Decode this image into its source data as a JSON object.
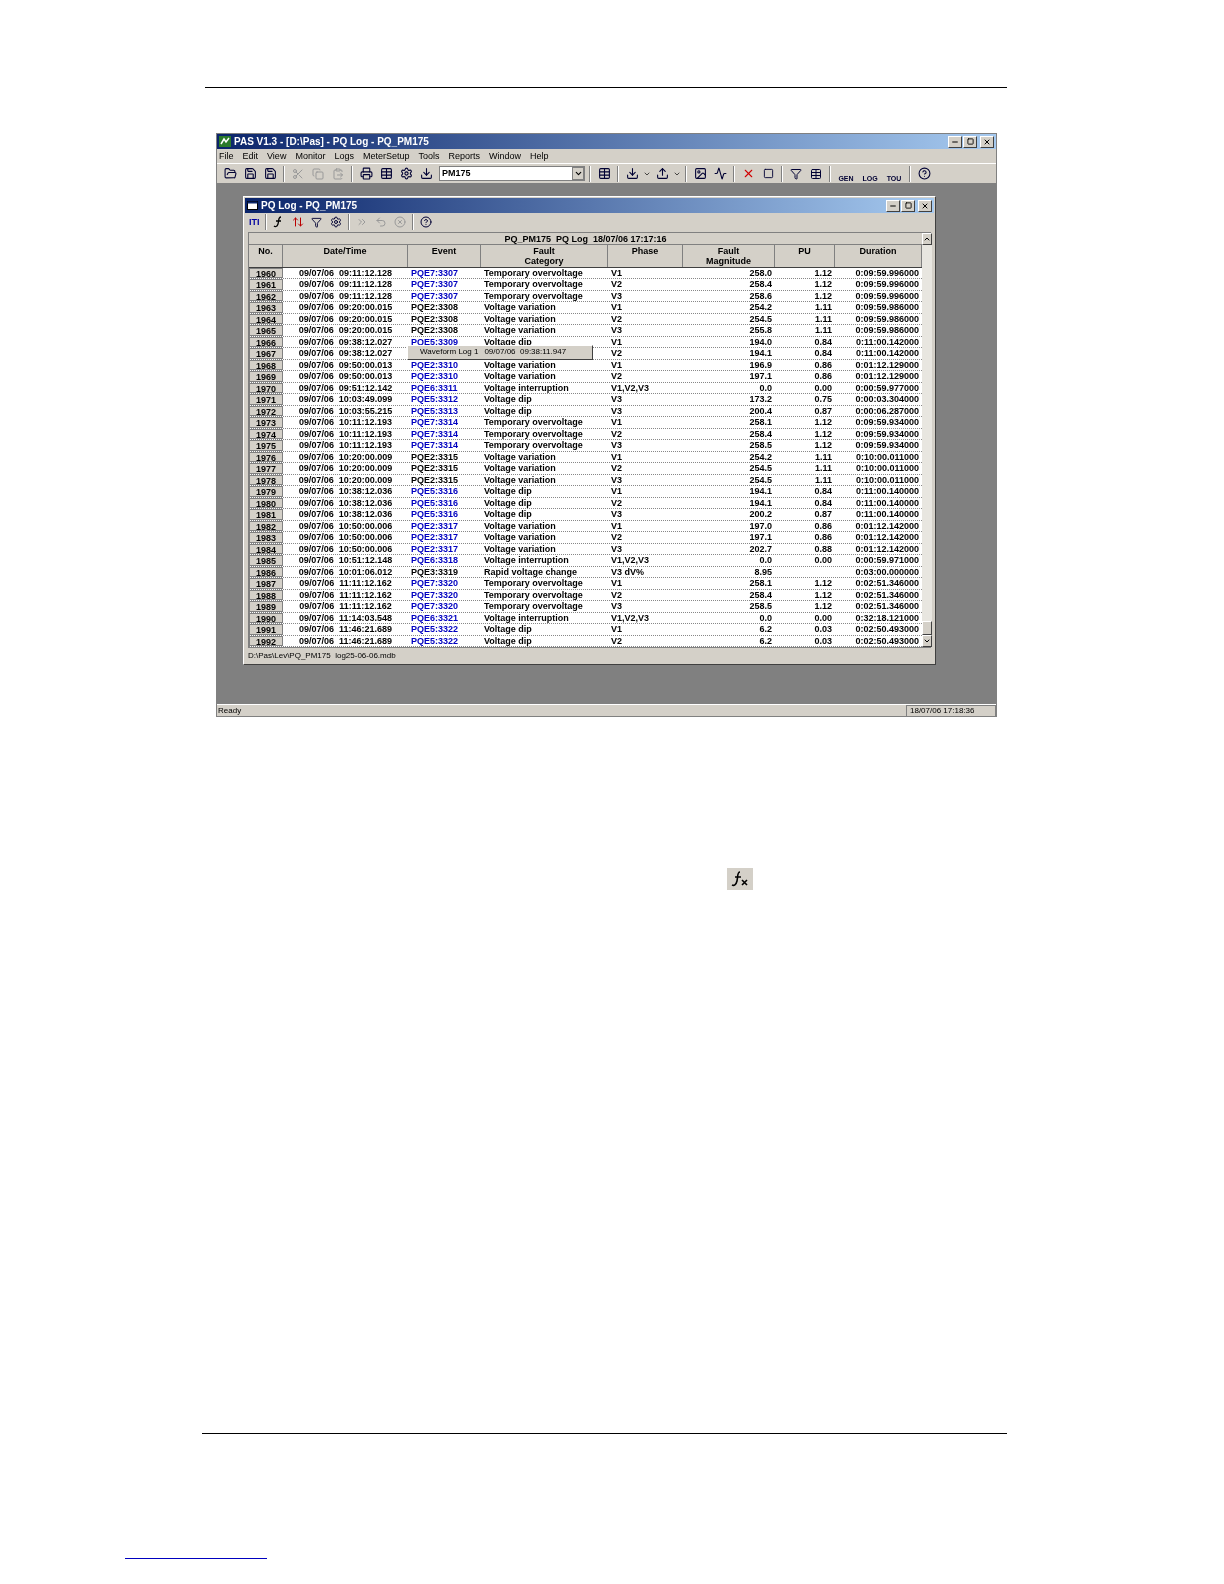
{
  "app_window": {
    "title": "PAS V1.3 - [D:\\Pas] - PQ Log - PQ_PM175",
    "menu": [
      "File",
      "Edit",
      "View",
      "Monitor",
      "Logs",
      "MeterSetup",
      "Tools",
      "Reports",
      "Window",
      "Help"
    ],
    "device_select": "PM175",
    "icon_labels": [
      "GEN",
      "LOG",
      "TOU"
    ]
  },
  "log_window": {
    "title": "PQ Log - PQ_PM175",
    "toolbar_label": "ITI",
    "table": {
      "caption": "PQ_PM175  PQ Log  18/07/06 17:17:16",
      "columns": [
        "No.",
        "Date/Time",
        "Event",
        "Fault\nCategory",
        "Phase",
        "Fault\nMagnitude",
        "PU",
        "Duration"
      ],
      "rows": [
        {
          "no": "1960",
          "datetime": "09/07/06  09:11:12.128",
          "event": "PQE7:3307",
          "link": true,
          "category": "Temporary overvoltage",
          "phase": "V1",
          "magnitude": "258.0",
          "pu": "1.12",
          "duration": "0:09:59.996000"
        },
        {
          "no": "1961",
          "datetime": "09/07/06  09:11:12.128",
          "event": "PQE7:3307",
          "link": true,
          "category": "Temporary overvoltage",
          "phase": "V2",
          "magnitude": "258.4",
          "pu": "1.12",
          "duration": "0:09:59.996000"
        },
        {
          "no": "1962",
          "datetime": "09/07/06  09:11:12.128",
          "event": "PQE7:3307",
          "link": true,
          "category": "Temporary overvoltage",
          "phase": "V3",
          "magnitude": "258.6",
          "pu": "1.12",
          "duration": "0:09:59.996000"
        },
        {
          "no": "1963",
          "datetime": "09/07/06  09:20:00.015",
          "event": "PQE2:3308",
          "link": false,
          "category": "Voltage variation",
          "phase": "V1",
          "magnitude": "254.2",
          "pu": "1.11",
          "duration": "0:09:59.986000"
        },
        {
          "no": "1964",
          "datetime": "09/07/06  09:20:00.015",
          "event": "PQE2:3308",
          "link": false,
          "category": "Voltage variation",
          "phase": "V2",
          "magnitude": "254.5",
          "pu": "1.11",
          "duration": "0:09:59.986000"
        },
        {
          "no": "1965",
          "datetime": "09/07/06  09:20:00.015",
          "event": "PQE2:3308",
          "link": false,
          "category": "Voltage variation",
          "phase": "V3",
          "magnitude": "255.8",
          "pu": "1.11",
          "duration": "0:09:59.986000"
        },
        {
          "no": "1966",
          "datetime": "09/07/06  09:38:12.027",
          "event": "PQE5:3309",
          "link": true,
          "category": "Voltage dip",
          "phase": "V1",
          "magnitude": "194.0",
          "pu": "0.84",
          "duration": "0:11:00.142000"
        },
        {
          "no": "1967",
          "datetime": "09/07/06  09:38:12.027",
          "phase": "V2",
          "magnitude": "194.1",
          "pu": "0.84",
          "duration": "0:11:00.142000"
        },
        {
          "no": "1968",
          "datetime": "09/07/06  09:50:00.013",
          "event": "PQE2:3310",
          "link": true,
          "category": "Voltage variation",
          "phase": "V1",
          "magnitude": "196.9",
          "pu": "0.86",
          "duration": "0:01:12.129000"
        },
        {
          "no": "1969",
          "datetime": "09/07/06  09:50:00.013",
          "event": "PQE2:3310",
          "link": true,
          "category": "Voltage variation",
          "phase": "V2",
          "magnitude": "197.1",
          "pu": "0.86",
          "duration": "0:01:12.129000"
        },
        {
          "no": "1970",
          "datetime": "09/07/06  09:51:12.142",
          "event": "PQE6:3311",
          "link": true,
          "category": "Voltage interruption",
          "phase": "V1,V2,V3",
          "magnitude": "0.0",
          "pu": "0.00",
          "duration": "0:00:59.977000"
        },
        {
          "no": "1971",
          "datetime": "09/07/06  10:03:49.099",
          "event": "PQE5:3312",
          "link": true,
          "category": "Voltage dip",
          "phase": "V3",
          "magnitude": "173.2",
          "pu": "0.75",
          "duration": "0:00:03.304000"
        },
        {
          "no": "1972",
          "datetime": "09/07/06  10:03:55.215",
          "event": "PQE5:3313",
          "link": true,
          "category": "Voltage dip",
          "phase": "V3",
          "magnitude": "200.4",
          "pu": "0.87",
          "duration": "0:00:06.287000"
        },
        {
          "no": "1973",
          "datetime": "09/07/06  10:11:12.193",
          "event": "PQE7:3314",
          "link": true,
          "category": "Temporary overvoltage",
          "phase": "V1",
          "magnitude": "258.1",
          "pu": "1.12",
          "duration": "0:09:59.934000"
        },
        {
          "no": "1974",
          "datetime": "09/07/06  10:11:12.193",
          "event": "PQE7:3314",
          "link": true,
          "category": "Temporary overvoltage",
          "phase": "V2",
          "magnitude": "258.4",
          "pu": "1.12",
          "duration": "0:09:59.934000"
        },
        {
          "no": "1975",
          "datetime": "09/07/06  10:11:12.193",
          "event": "PQE7:3314",
          "link": true,
          "category": "Temporary overvoltage",
          "phase": "V3",
          "magnitude": "258.5",
          "pu": "1.12",
          "duration": "0:09:59.934000"
        },
        {
          "no": "1976",
          "datetime": "09/07/06  10:20:00.009",
          "event": "PQE2:3315",
          "link": false,
          "category": "Voltage variation",
          "phase": "V1",
          "magnitude": "254.2",
          "pu": "1.11",
          "duration": "0:10:00.011000"
        },
        {
          "no": "1977",
          "datetime": "09/07/06  10:20:00.009",
          "event": "PQE2:3315",
          "link": false,
          "category": "Voltage variation",
          "phase": "V2",
          "magnitude": "254.5",
          "pu": "1.11",
          "duration": "0:10:00.011000"
        },
        {
          "no": "1978",
          "datetime": "09/07/06  10:20:00.009",
          "event": "PQE2:3315",
          "link": false,
          "category": "Voltage variation",
          "phase": "V3",
          "magnitude": "254.5",
          "pu": "1.11",
          "duration": "0:10:00.011000"
        },
        {
          "no": "1979",
          "datetime": "09/07/06  10:38:12.036",
          "event": "PQE5:3316",
          "link": true,
          "category": "Voltage dip",
          "phase": "V1",
          "magnitude": "194.1",
          "pu": "0.84",
          "duration": "0:11:00.140000"
        },
        {
          "no": "1980",
          "datetime": "09/07/06  10:38:12.036",
          "event": "PQE5:3316",
          "link": true,
          "category": "Voltage dip",
          "phase": "V2",
          "magnitude": "194.1",
          "pu": "0.84",
          "duration": "0:11:00.140000"
        },
        {
          "no": "1981",
          "datetime": "09/07/06  10:38:12.036",
          "event": "PQE5:3316",
          "link": true,
          "category": "Voltage dip",
          "phase": "V3",
          "magnitude": "200.2",
          "pu": "0.87",
          "duration": "0:11:00.140000"
        },
        {
          "no": "1982",
          "datetime": "09/07/06  10:50:00.006",
          "event": "PQE2:3317",
          "link": true,
          "category": "Voltage variation",
          "phase": "V1",
          "magnitude": "197.0",
          "pu": "0.86",
          "duration": "0:01:12.142000"
        },
        {
          "no": "1983",
          "datetime": "09/07/06  10:50:00.006",
          "event": "PQE2:3317",
          "link": true,
          "category": "Voltage variation",
          "phase": "V2",
          "magnitude": "197.1",
          "pu": "0.86",
          "duration": "0:01:12.142000"
        },
        {
          "no": "1984",
          "datetime": "09/07/06  10:50:00.006",
          "event": "PQE2:3317",
          "link": true,
          "category": "Voltage variation",
          "phase": "V3",
          "magnitude": "202.7",
          "pu": "0.88",
          "duration": "0:01:12.142000"
        },
        {
          "no": "1985",
          "datetime": "09/07/06  10:51:12.148",
          "event": "PQE6:3318",
          "link": true,
          "category": "Voltage interruption",
          "phase": "V1,V2,V3",
          "magnitude": "0.0",
          "pu": "0.00",
          "duration": "0:00:59.971000"
        },
        {
          "no": "1986",
          "datetime": "09/07/06  10:01:06.012",
          "event": "PQE3:3319",
          "link": false,
          "category": "Rapid voltage change",
          "phase": "V3 dV%",
          "magnitude": "8.95",
          "duration": "0:03:00.000000"
        },
        {
          "no": "1987",
          "datetime": "09/07/06  11:11:12.162",
          "event": "PQE7:3320",
          "link": true,
          "category": "Temporary overvoltage",
          "phase": "V1",
          "magnitude": "258.1",
          "pu": "1.12",
          "duration": "0:02:51.346000"
        },
        {
          "no": "1988",
          "datetime": "09/07/06  11:11:12.162",
          "event": "PQE7:3320",
          "link": true,
          "category": "Temporary overvoltage",
          "phase": "V2",
          "magnitude": "258.4",
          "pu": "1.12",
          "duration": "0:02:51.346000"
        },
        {
          "no": "1989",
          "datetime": "09/07/06  11:11:12.162",
          "event": "PQE7:3320",
          "link": true,
          "category": "Temporary overvoltage",
          "phase": "V3",
          "magnitude": "258.5",
          "pu": "1.12",
          "duration": "0:02:51.346000"
        },
        {
          "no": "1990",
          "datetime": "09/07/06  11:14:03.548",
          "event": "PQE6:3321",
          "link": true,
          "category": "Voltage interruption",
          "phase": "V1,V2,V3",
          "magnitude": "0.0",
          "pu": "0.00",
          "duration": "0:32:18.121000"
        },
        {
          "no": "1991",
          "datetime": "09/07/06  11:46:21.689",
          "event": "PQE5:3322",
          "link": true,
          "category": "Voltage dip",
          "phase": "V1",
          "magnitude": "6.2",
          "pu": "0.03",
          "duration": "0:02:50.493000"
        },
        {
          "no": "1992",
          "datetime": "09/07/06  11:46:21.689",
          "event": "PQE5:3322",
          "link": true,
          "category": "Voltage dip",
          "phase": "V2",
          "magnitude": "6.2",
          "pu": "0.03",
          "duration": "0:02:50.493000"
        }
      ]
    },
    "tooltip": {
      "label": "Waveform Log 1",
      "time": "09/07/06  09:38:11.947"
    },
    "status_path": "D:\\Pas\\Lev\\PQ_PM175  log25-06-06.mdb"
  },
  "status_bar": {
    "text": "Ready",
    "datetime": "18/07/06 17:18:36"
  }
}
